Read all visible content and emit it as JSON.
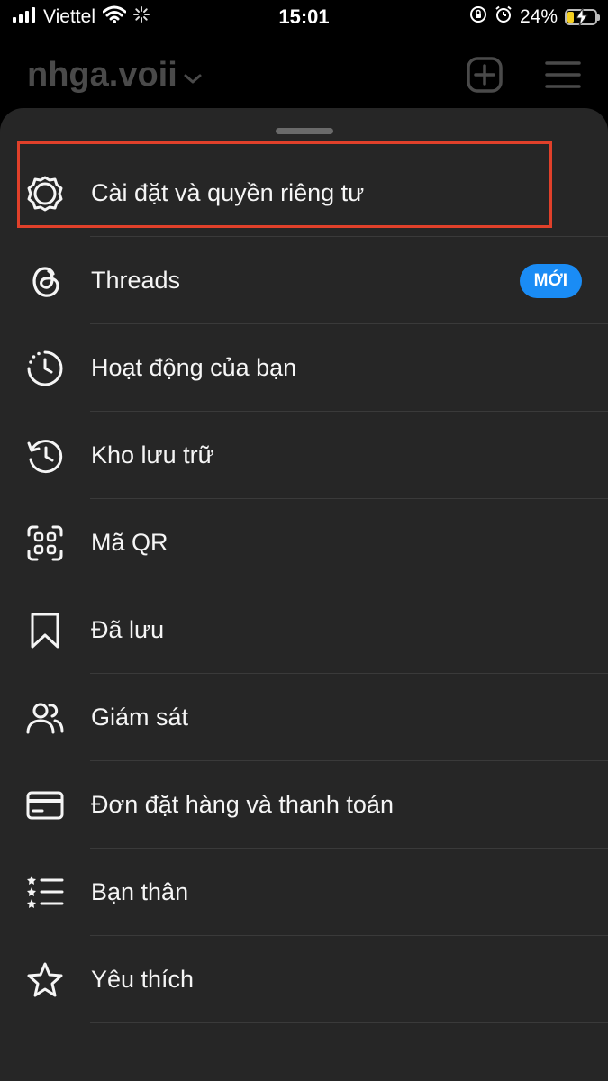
{
  "status_bar": {
    "carrier": "Viettel",
    "time": "15:01",
    "battery_percent": "24%",
    "battery_level": 0.24
  },
  "header": {
    "username": "nhga.voii"
  },
  "menu": {
    "items": [
      {
        "label": "Cài đặt và quyền riêng tư",
        "icon": "settings-gear-icon"
      },
      {
        "label": "Threads",
        "icon": "threads-icon",
        "badge": "MỚI"
      },
      {
        "label": "Hoạt động của bạn",
        "icon": "activity-clock-icon"
      },
      {
        "label": "Kho lưu trữ",
        "icon": "archive-history-icon"
      },
      {
        "label": "Mã QR",
        "icon": "qr-code-icon"
      },
      {
        "label": "Đã lưu",
        "icon": "bookmark-icon"
      },
      {
        "label": "Giám sát",
        "icon": "supervision-people-icon"
      },
      {
        "label": "Đơn đặt hàng và thanh toán",
        "icon": "credit-card-icon"
      },
      {
        "label": "Bạn thân",
        "icon": "close-friends-list-icon"
      },
      {
        "label": "Yêu thích",
        "icon": "star-icon"
      }
    ]
  },
  "colors": {
    "sheet_background": "#262626",
    "badge_blue": "#1a8cf5",
    "highlight_red": "#e0402a",
    "battery_yellow": "#f5d020"
  }
}
